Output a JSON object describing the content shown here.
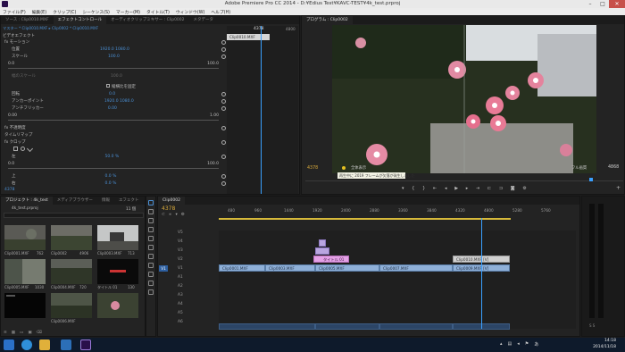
{
  "window": {
    "title": "Adobe Premiere Pro CC 2014 - D:¥Edius Test¥KAVC-TEST¥4k_test.prproj"
  },
  "menu": [
    "ファイル(F)",
    "編集(E)",
    "クリップ(C)",
    "シーケンス(S)",
    "マーカー(M)",
    "タイトル(T)",
    "ウィンドウ(W)",
    "ヘルプ(H)"
  ],
  "effects_panel": {
    "tabs": [
      "ソース : Clip0010.MXF",
      "エフェクトコントロール",
      "オーディオクリップミキサー : Clip0002",
      "メタデータ"
    ],
    "breadcrumb": "マスター * Clip0010.MXF ▸ Clip0002 * Clip0010.MXF",
    "section": "ビデオエフェクト",
    "clip_label": "Clip0010.MXF",
    "timecode": "4378",
    "ruler_end": "4800",
    "bottom_timecode": "4378",
    "rows": [
      {
        "name": "fx  モーション",
        "value": ""
      },
      {
        "name": "位置",
        "value": "1920.0     1080.0"
      },
      {
        "name": "スケール",
        "value": "100.0"
      },
      {
        "name": "0.0",
        "value": "100.0"
      },
      {
        "name": "幅のスケール",
        "value": "100.0"
      },
      {
        "name": "",
        "value": "縦横比を固定"
      },
      {
        "name": "回転",
        "value": "0.0"
      },
      {
        "name": "アンカーポイント",
        "value": "1920.0     1080.0"
      },
      {
        "name": "アンチフリッカー",
        "value": "0.00"
      },
      {
        "name": "0.00",
        "value": "1.00"
      },
      {
        "name": "fx  不透明度",
        "value": ""
      },
      {
        "name": "タイムリマップ",
        "value": ""
      },
      {
        "name": "fx  クロップ",
        "value": ""
      },
      {
        "name": "左",
        "value": "50.0 %"
      },
      {
        "name": "0.0",
        "value": "100.0"
      },
      {
        "name": "上",
        "value": "0.0 %"
      },
      {
        "name": "右",
        "value": "0.0 %"
      }
    ]
  },
  "program": {
    "tab": "プログラム : Clip0002",
    "timecode_left": "4378",
    "timecode_right": "4868",
    "fit": "全体表示",
    "quality": "フル画質",
    "tooltip": "再生中に 2019 フレームが欠落が発生しました"
  },
  "project": {
    "tabs": [
      "プロジェクト : 4k_test",
      "メディアブラウザー",
      "情報",
      "エフェクト"
    ],
    "filename": "4k_test.prproj",
    "count": "11 個",
    "items": [
      {
        "name": "Clip0001.MXF",
        "dur": "762"
      },
      {
        "name": "Clip0002",
        "dur": "4906"
      },
      {
        "name": "Clip0003.MXF",
        "dur": "713"
      },
      {
        "name": "Clip0005.MXF",
        "dur": "1030"
      },
      {
        "name": "Clip0004.MXF",
        "dur": "720"
      },
      {
        "name": "Clip0006.MXF",
        "dur": "1300"
      },
      {
        "name": "タイトル 01",
        "dur": "130"
      }
    ]
  },
  "timeline": {
    "tab": "Clip0002",
    "timecode": "4378",
    "ruler": [
      "480",
      "960",
      "1440",
      "1920",
      "2400",
      "2880",
      "3360",
      "3840",
      "4320",
      "4800",
      "5280",
      "5760"
    ],
    "video_tracks": [
      "V5",
      "V4",
      "V3",
      "V2",
      "V1"
    ],
    "audio_tracks": [
      "A1",
      "A2",
      "A3",
      "A4",
      "A5",
      "A6"
    ],
    "clips_v1": [
      {
        "name": "Clip0001.MXF"
      },
      {
        "name": "Clip0003.MXF"
      },
      {
        "name": "Clip0005.MXF"
      },
      {
        "name": "Clip0007.MXF"
      },
      {
        "name": "Clip0009.MXF [V]"
      }
    ],
    "clip_v2": {
      "name": "Clip0010.MXF [V]"
    },
    "title_clip": {
      "name": "タイトル 01"
    }
  },
  "taskbar": {
    "time": "14:18",
    "date": "2014/11/18"
  },
  "colors": {
    "accent": "#4a8fd4",
    "clip": "#8fb0d8",
    "title_clip": "#d48ad8",
    "playhead": "#3aa0ff"
  }
}
